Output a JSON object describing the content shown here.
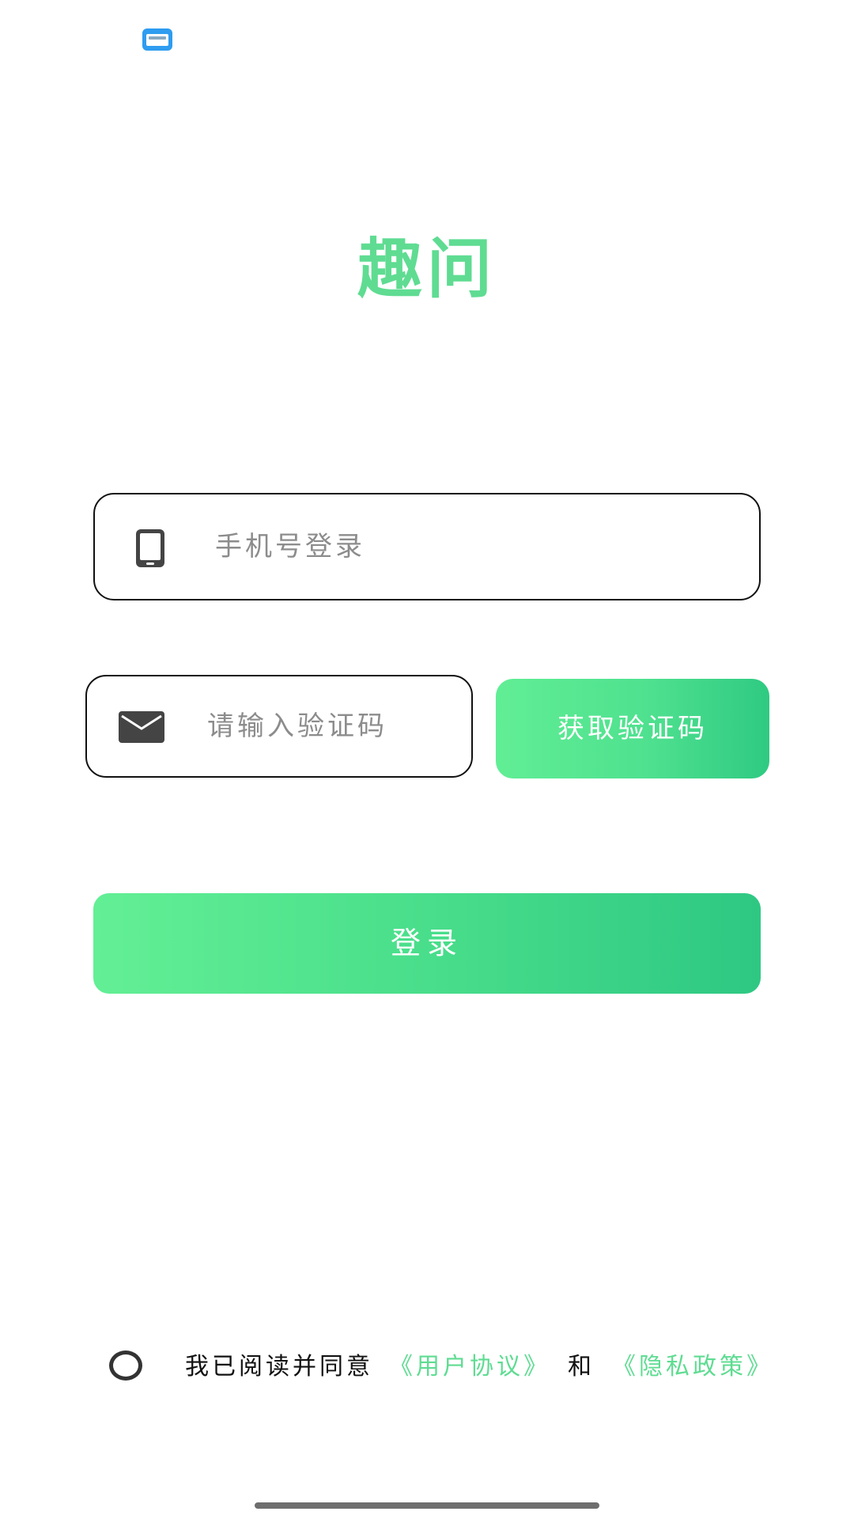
{
  "app": {
    "title": "趣问"
  },
  "login_form": {
    "phone_placeholder": "手机号登录",
    "code_placeholder": "请输入验证码",
    "get_code_label": "获取验证码",
    "login_label": "登录"
  },
  "agreement": {
    "prefix": "我已阅读并同意",
    "user_agreement": "《用户协议》",
    "connector": "和",
    "privacy_policy": "《隐私政策》"
  },
  "colors": {
    "accent": "#5fdc92",
    "gradient_start": "#63ef95",
    "gradient_end": "#2ec883",
    "border": "#111111",
    "placeholder": "#8c8c8c",
    "icon": "#444444"
  },
  "icons": {
    "status": "notification-card-icon",
    "phone": "mobile-phone-icon",
    "code": "envelope-icon"
  }
}
